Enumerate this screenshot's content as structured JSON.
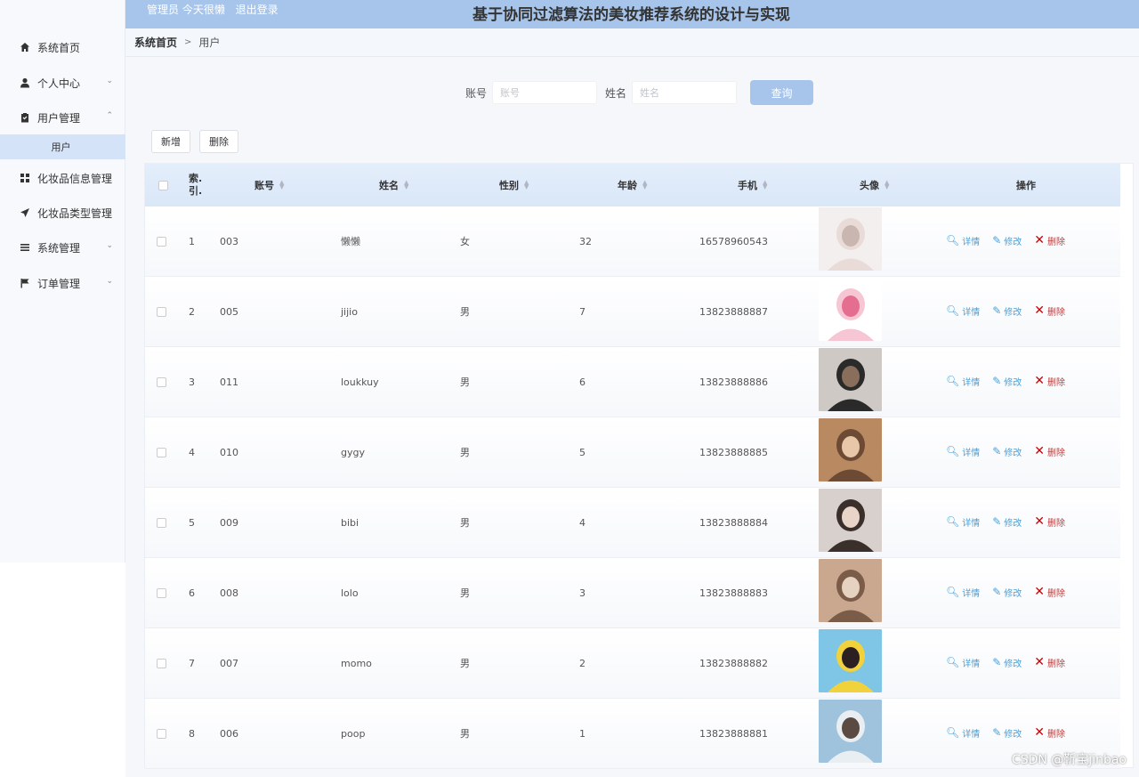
{
  "header": {
    "admin_label": "管理员 今天很懒",
    "logout_label": "退出登录",
    "title": "基于协同过滤算法的美妆推荐系统的设计与实现",
    "bar_color": "#a7c5eb"
  },
  "sidebar": {
    "items": [
      {
        "label": "系统首页",
        "icon": "home-icon",
        "expandable": false
      },
      {
        "label": "个人中心",
        "icon": "user-icon",
        "expandable": true
      },
      {
        "label": "用户管理",
        "icon": "clipboard-icon",
        "expandable": true,
        "expanded": true
      },
      {
        "label": "化妆品信息管理",
        "icon": "grid-icon",
        "expandable": true
      },
      {
        "label": "化妆品类型管理",
        "icon": "send-icon",
        "expandable": true
      },
      {
        "label": "系统管理",
        "icon": "list-icon",
        "expandable": true
      },
      {
        "label": "订单管理",
        "icon": "flag-icon",
        "expandable": true
      }
    ],
    "sub_item": "用户"
  },
  "breadcrumb": {
    "home": "系统首页",
    "separator": ">",
    "current": "用户"
  },
  "search": {
    "account_label": "账号",
    "account_placeholder": "账号",
    "name_label": "姓名",
    "name_placeholder": "姓名",
    "query_label": "查询"
  },
  "actions": {
    "add_label": "新增",
    "delete_label": "删除"
  },
  "table": {
    "columns": [
      "索.引.",
      "账号",
      "姓名",
      "性别",
      "年龄",
      "手机",
      "头像",
      "操作"
    ],
    "op_labels": {
      "detail": "详情",
      "edit": "修改",
      "delete": "删除"
    },
    "rows": [
      {
        "index": "1",
        "account": "003",
        "name": "懒懒",
        "gender": "女",
        "age": "32",
        "phone": "16578960543"
      },
      {
        "index": "2",
        "account": "005",
        "name": "jijio",
        "gender": "男",
        "age": "7",
        "phone": "13823888887"
      },
      {
        "index": "3",
        "account": "011",
        "name": "loukkuy",
        "gender": "男",
        "age": "6",
        "phone": "13823888886"
      },
      {
        "index": "4",
        "account": "010",
        "name": "gygy",
        "gender": "男",
        "age": "5",
        "phone": "13823888885"
      },
      {
        "index": "5",
        "account": "009",
        "name": "bibi",
        "gender": "男",
        "age": "4",
        "phone": "13823888884"
      },
      {
        "index": "6",
        "account": "008",
        "name": "lolo",
        "gender": "男",
        "age": "3",
        "phone": "13823888883"
      },
      {
        "index": "7",
        "account": "007",
        "name": "momo",
        "gender": "男",
        "age": "2",
        "phone": "13823888882"
      },
      {
        "index": "8",
        "account": "006",
        "name": "poop",
        "gender": "男",
        "age": "1",
        "phone": "13823888881"
      }
    ]
  },
  "watermark": "CSDN @靳宝jinbao"
}
